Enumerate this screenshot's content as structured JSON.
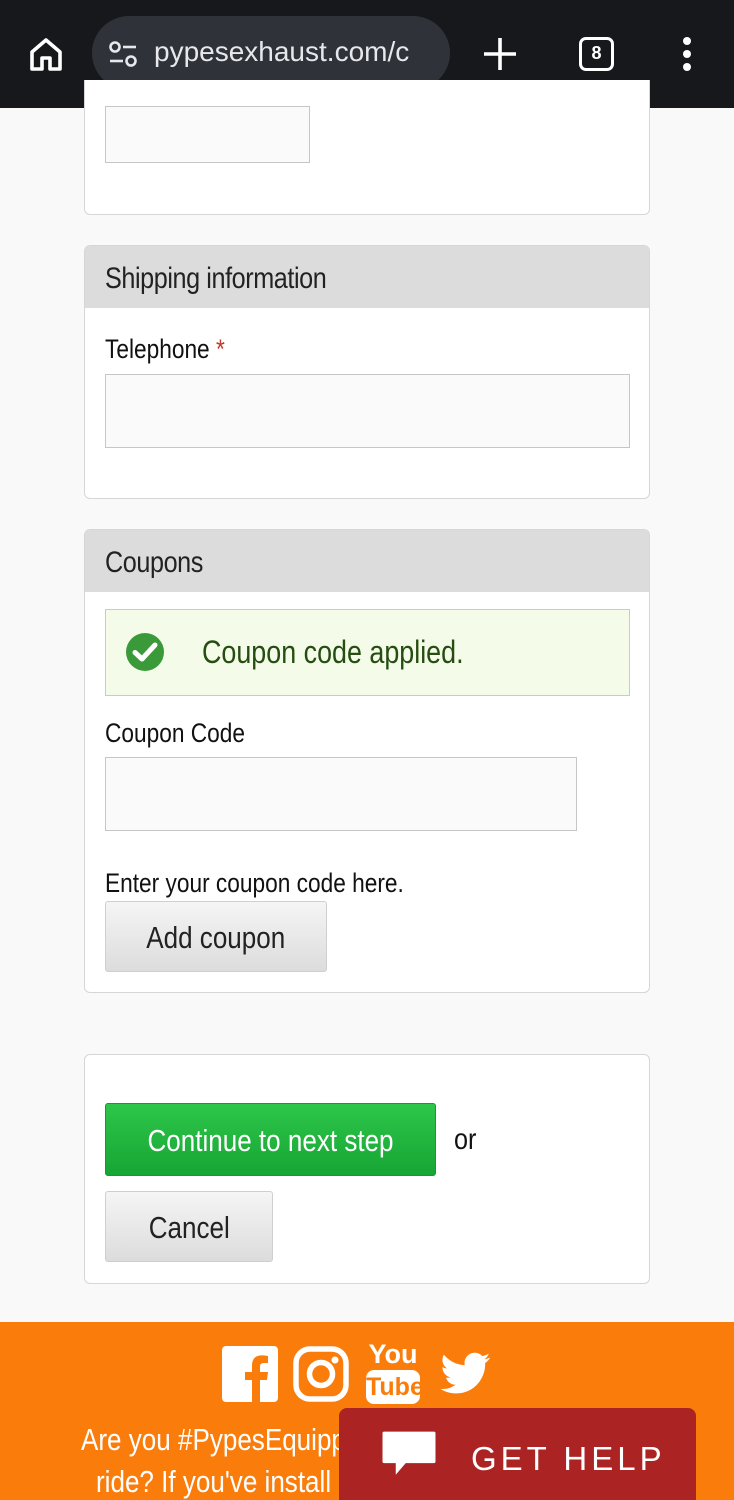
{
  "browser": {
    "url": "pypesexhaust.com/c",
    "tab_count": "8",
    "icons": [
      "home-icon",
      "site-settings-icon",
      "new-tab-icon",
      "tab-switcher-icon",
      "more-menu-icon"
    ]
  },
  "shipping": {
    "heading": "Shipping information",
    "telephone_label": "Telephone",
    "required_mark": "*",
    "telephone_value": ""
  },
  "coupons": {
    "heading": "Coupons",
    "status_message": "Coupon code applied.",
    "coupon_label": "Coupon Code",
    "coupon_value": "",
    "help_text": "Enter your coupon code here.",
    "add_button": "Add coupon"
  },
  "actions": {
    "continue_button": "Continue to next step",
    "or_text": "or",
    "cancel_button": "Cancel"
  },
  "footer": {
    "social_icons": [
      "facebook-icon",
      "instagram-icon",
      "youtube-icon",
      "twitter-icon"
    ],
    "youtube_logo_top": "You",
    "youtube_logo_bottom": "Tube",
    "promo_line1": "Are you #PypesEquipp",
    "promo_line2": "ride? If you've install"
  },
  "help_widget": {
    "label": "GET HELP"
  },
  "colors": {
    "browser_bar": "#17181c",
    "primary_green": "#1fb43d",
    "footer_orange": "#fa7d0c",
    "help_red": "#ab2322",
    "success_text": "#264d12"
  }
}
